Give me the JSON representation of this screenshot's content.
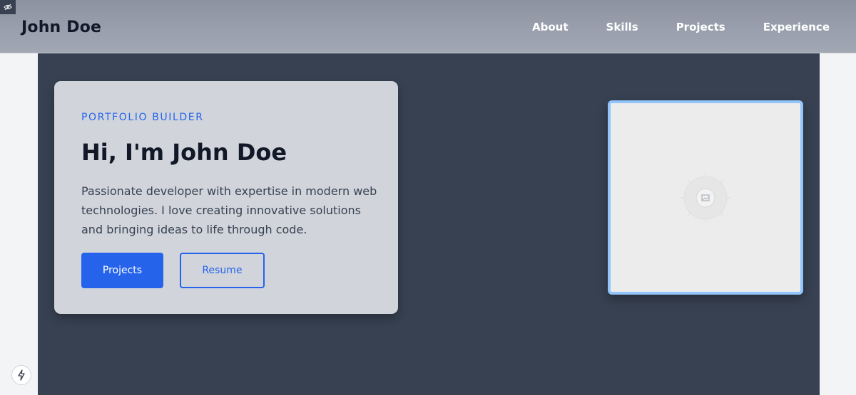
{
  "header": {
    "brand": "John Doe",
    "nav": [
      "About",
      "Skills",
      "Projects",
      "Experience"
    ]
  },
  "hero": {
    "eyebrow": "PORTFOLIO BUILDER",
    "headline": "Hi, I'm John Doe",
    "description": "Passionate developer with expertise in modern web technologies. I love creating innovative solutions and bringing ideas to life through code.",
    "primary_button": "Projects",
    "secondary_button": "Resume",
    "image": {
      "icon": "image-placeholder-icon"
    }
  },
  "icons": {
    "corner_badge": "eye-off-icon",
    "fab": "lightning-icon"
  },
  "colors": {
    "accent": "#2563eb",
    "hero_bg": "#374151",
    "card_bg": "#d1d5db",
    "image_border": "#93c5fd"
  }
}
